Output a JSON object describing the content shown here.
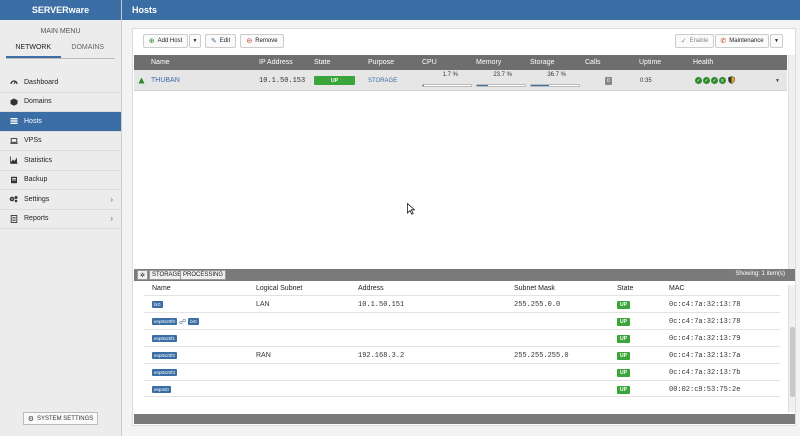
{
  "sidebar": {
    "brand": "SERVERware",
    "main_menu_label": "MAIN MENU",
    "tabs": [
      {
        "label": "NETWORK",
        "active": true
      },
      {
        "label": "DOMAINS",
        "active": false
      }
    ],
    "items": [
      {
        "label": "Dashboard",
        "icon": "dashboard-icon"
      },
      {
        "label": "Domains",
        "icon": "cube-icon"
      },
      {
        "label": "Hosts",
        "icon": "list-icon",
        "active": true
      },
      {
        "label": "VPSs",
        "icon": "laptop-icon"
      },
      {
        "label": "Statistics",
        "icon": "chart-icon"
      },
      {
        "label": "Backup",
        "icon": "backup-icon"
      },
      {
        "label": "Settings",
        "icon": "gears-icon",
        "chevron": true
      },
      {
        "label": "Reports",
        "icon": "report-icon",
        "chevron": true
      }
    ],
    "system_settings_label": "SYSTEM SETTINGS"
  },
  "topbar": {
    "title": "Hosts"
  },
  "toolbar": {
    "add_host": "Add Host",
    "edit": "Edit",
    "remove": "Remove",
    "enable": "Enable",
    "maintenance": "Maintenance"
  },
  "hosts_table": {
    "columns": [
      "Name",
      "IP Address",
      "State",
      "Purpose",
      "CPU",
      "Memory",
      "Storage",
      "Calls",
      "Uptime",
      "Health"
    ],
    "rows": [
      {
        "name": "THUBAN",
        "ip": "10.1.50.153",
        "state": "UP",
        "purpose": "STORAGE",
        "cpu": "1.7 %",
        "cpu_pct": 1.7,
        "memory": "23.7 %",
        "memory_pct": 23.7,
        "storage": "36.7 %",
        "storage_pct": 36.7,
        "calls": "0",
        "uptime": "0:35"
      }
    ]
  },
  "detail": {
    "tabs": [
      "STORAGE",
      "PROCESSING"
    ],
    "showing": "Showing: 1 item(s)",
    "columns": [
      "Name",
      "Logical Subnet",
      "Address",
      "Subnet Mask",
      "State",
      "MAC"
    ],
    "rows": [
      {
        "name": "br0",
        "subnet": "LAN",
        "address": "10.1.50.151",
        "mask": "255.255.0.0",
        "state": "UP",
        "mac": "0c:c4:7a:32:13:78"
      },
      {
        "name": "enp0s20f0",
        "bridge": "br0",
        "subnet": "",
        "address": "",
        "mask": "",
        "state": "UP",
        "mac": "0c:c4:7a:32:13:78"
      },
      {
        "name": "enp0s20f1",
        "subnet": "",
        "address": "",
        "mask": "",
        "state": "UP",
        "mac": "0c:c4:7a:32:13:79"
      },
      {
        "name": "enp0s20f2",
        "subnet": "RAN",
        "address": "192.168.3.2",
        "mask": "255.255.255.0",
        "state": "UP",
        "mac": "0c:c4:7a:32:13:7a"
      },
      {
        "name": "enp0s20f3",
        "subnet": "",
        "address": "",
        "mask": "",
        "state": "UP",
        "mac": "0c:c4:7a:32:13:7b"
      },
      {
        "name": "enp4s0",
        "subnet": "",
        "address": "",
        "mask": "",
        "state": "UP",
        "mac": "00:02:c9:53:75:2e"
      }
    ]
  },
  "colors": {
    "accent": "#3a6ea5",
    "up_green": "#3aa53a",
    "cpu_bar": "#c0392b",
    "mem_bar": "#3a6ea5",
    "storage_bar": "#3a6ea5"
  }
}
